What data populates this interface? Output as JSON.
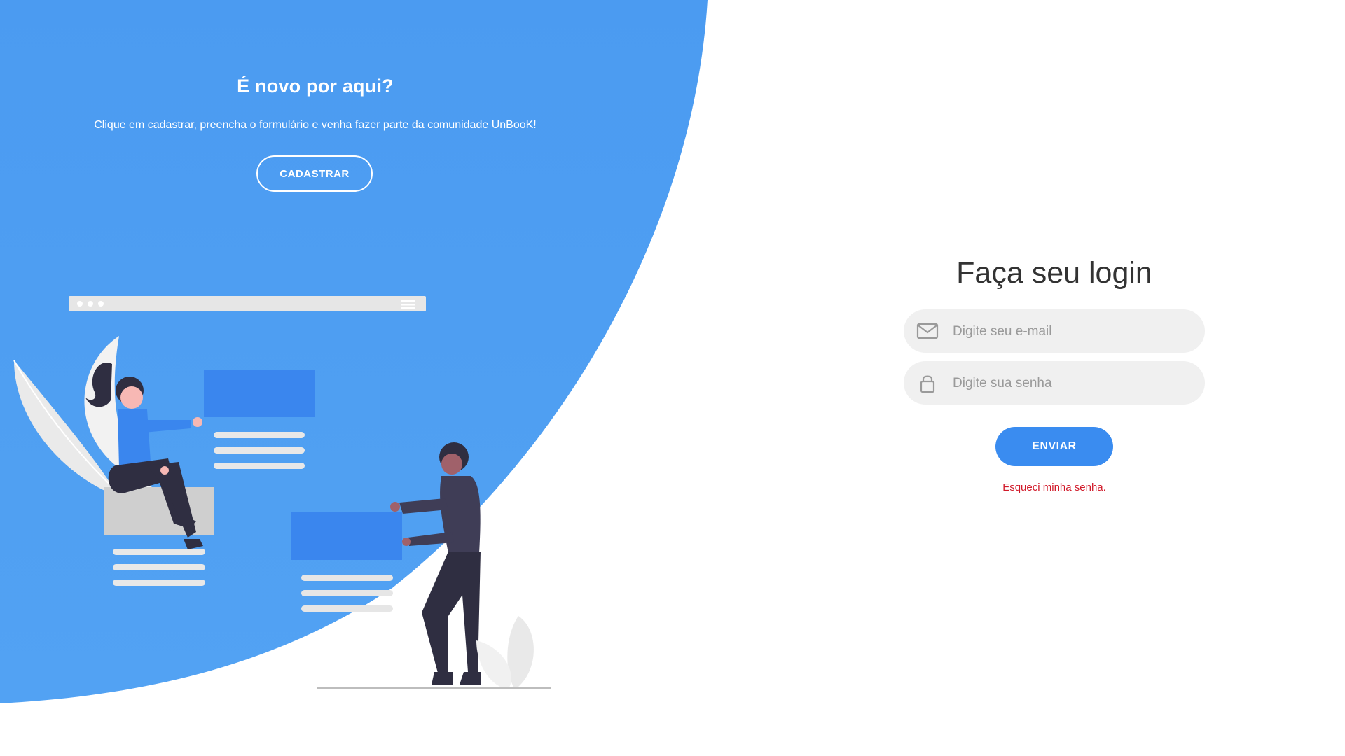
{
  "promo": {
    "title": "É novo por aqui?",
    "text": "Clique em cadastrar, preencha o formulário e venha fazer parte da comunidade UnBooK!",
    "register_label": "CADASTRAR"
  },
  "login": {
    "title": "Faça seu login",
    "email_placeholder": "Digite seu e-mail",
    "password_placeholder": "Digite sua senha",
    "submit_label": "ENVIAR",
    "forgot_label": "Esqueci minha senha."
  },
  "colors": {
    "brand_blue": "#4a9af0",
    "button_blue": "#3a8cf0",
    "link_red": "#d11a2a",
    "field_bg": "#f0f0f0"
  },
  "icons": {
    "email": "envelope-icon",
    "password": "lock-icon"
  }
}
